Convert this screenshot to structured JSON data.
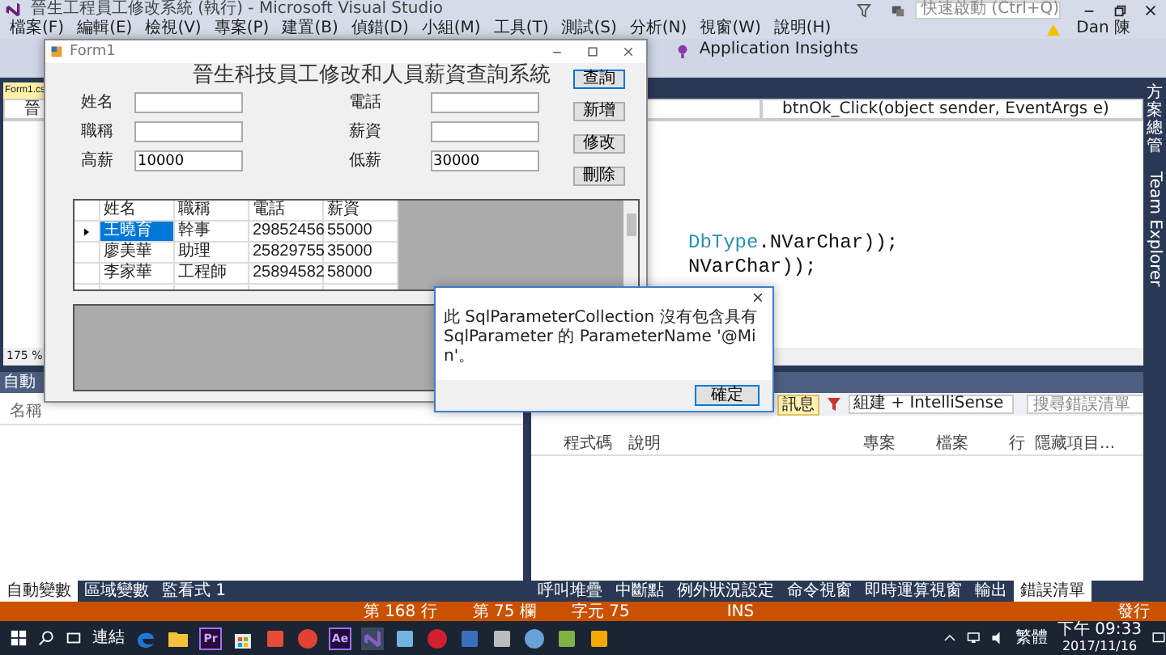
{
  "ide": {
    "title": "晉生工程員工修改系統 (執行) - Microsoft Visual Studio",
    "menu": [
      "檔案(F)",
      "編輯(E)",
      "檢視(V)",
      "專案(P)",
      "建置(B)",
      "偵錯(D)",
      "小組(M)",
      "工具(T)",
      "測試(S)",
      "分析(N)",
      "視窗(W)",
      "說明(H)"
    ],
    "quick_launch": {
      "placeholder": "快速啟動 (Ctrl+Q)"
    },
    "user": "Dan 陳",
    "application_insights": "Application Insights"
  },
  "editor": {
    "tab": "Form1.cs",
    "class_dropdown": "晉",
    "member_dropdown": "btnOk_Click(object sender, EventArgs e)",
    "code_lines": [
      [
        {
          "text": "DbType",
          "kind": "type"
        },
        {
          "text": ".NVarChar));",
          "kind": "plain"
        }
      ],
      [
        {
          "text": "NVarChar));",
          "kind": "plain"
        }
      ]
    ],
    "zoom": "175 %"
  },
  "side_tabs": [
    {
      "label": "方案總管",
      "kind": "cjk"
    },
    {
      "label": "Team Explorer",
      "kind": "latin"
    }
  ],
  "autos": {
    "title": "自動",
    "columns": [
      "名稱"
    ],
    "tabs": [
      {
        "label": "自動變數",
        "selected": true
      },
      {
        "label": "區域變數",
        "selected": false
      },
      {
        "label": "監看式 1",
        "selected": false
      }
    ]
  },
  "error_list": {
    "filter_message": "訊息",
    "scope": "組建 + IntelliSense",
    "search": {
      "placeholder": "搜尋錯誤清單"
    },
    "columns": [
      "程式碼",
      "說明",
      "專案",
      "檔案",
      "行",
      "隱藏項目..."
    ],
    "tabs": [
      {
        "label": "呼叫堆疊",
        "selected": false
      },
      {
        "label": "中斷點",
        "selected": false
      },
      {
        "label": "例外狀況設定",
        "selected": false
      },
      {
        "label": "命令視窗",
        "selected": false
      },
      {
        "label": "即時運算視窗",
        "selected": false
      },
      {
        "label": "輸出",
        "selected": false
      },
      {
        "label": "錯誤清單",
        "selected": true
      }
    ]
  },
  "status_bar": {
    "line": "第 168 行",
    "column": "第 75 欄",
    "char": "字元 75",
    "mode": "INS",
    "publish": "發行"
  },
  "taskbar": {
    "search_label": "連結",
    "apps": [
      {
        "kind": "edge",
        "color": "#1e78d7"
      },
      {
        "kind": "folder",
        "color": "#f3c13a"
      },
      {
        "kind": "badge",
        "label": "Pr",
        "color": "#2a0a3a"
      },
      {
        "kind": "bag",
        "color": "#e8e8e8"
      },
      {
        "kind": "tiles",
        "color": "#e84a3a"
      },
      {
        "kind": "circle",
        "color": "#e34133"
      },
      {
        "kind": "badge",
        "label": "Ae",
        "color": "#1f0a3a"
      },
      {
        "kind": "vs",
        "color": "#865fc5"
      },
      {
        "kind": "tiles",
        "color": "#6fb5e0"
      },
      {
        "kind": "circle",
        "color": "#d02030"
      },
      {
        "kind": "tiles",
        "color": "#3a6fc0"
      },
      {
        "kind": "tiles",
        "color": "#bcbcbc"
      },
      {
        "kind": "circle",
        "color": "#6aa0d8"
      },
      {
        "kind": "tiles",
        "color": "#7cb342"
      },
      {
        "kind": "tiles",
        "color": "#f2a900"
      }
    ],
    "language": "繁體",
    "time": "下午 09:33",
    "date": "2017/11/16"
  },
  "form": {
    "title": "Form1",
    "heading": "晉生科技員工修改和人員薪資查詢系統",
    "fields": [
      {
        "label": "姓名"
      },
      {
        "label": "電話"
      },
      {
        "label": "職稱"
      },
      {
        "label": "薪資"
      },
      {
        "label": "高薪",
        "value": "10000"
      },
      {
        "label": "低薪",
        "value": "30000"
      }
    ],
    "buttons": [
      "查詢",
      "新增",
      "修改",
      "刪除"
    ],
    "grid": {
      "columns": [
        "姓名",
        "職稱",
        "電話",
        "薪資"
      ],
      "rows": [
        {
          "cells": [
            "王曉育",
            "幹事",
            "29852456",
            "55000"
          ],
          "selected": true
        },
        {
          "cells": [
            "廖美華",
            "助理",
            "25829755",
            "35000"
          ],
          "selected": false
        },
        {
          "cells": [
            "李家華",
            "工程師",
            "25894582",
            "58000"
          ],
          "selected": false
        }
      ]
    }
  },
  "dialog": {
    "message": "此 SqlParameterCollection 沒有包含具有 SqlParameter 的 ParameterName '@Min'。",
    "button": "確定"
  }
}
